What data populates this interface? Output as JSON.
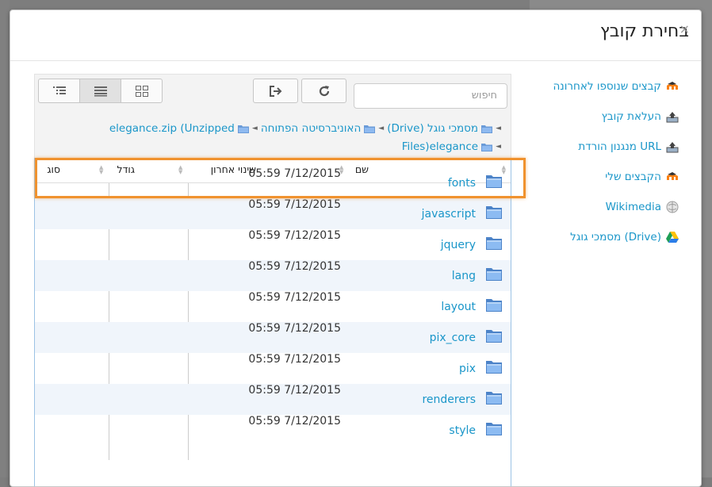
{
  "dialog": {
    "title": "בחירת קובץ",
    "close_glyph": "×"
  },
  "sidebar": {
    "items": [
      {
        "label": "קבצים שנוספו לאחרונה",
        "icon": "moodle-icon"
      },
      {
        "label": "העלאת קובץ",
        "icon": "upload-icon"
      },
      {
        "label": "מנגנון הורדת URL",
        "icon": "url-download-icon"
      },
      {
        "label": "הקבצים שלי",
        "icon": "moodle-icon"
      },
      {
        "label": "Wikimedia",
        "icon": "wikimedia-icon"
      },
      {
        "label": "מסמכי גוגל (Drive)",
        "icon": "google-drive-icon"
      }
    ]
  },
  "toolbar": {
    "search_placeholder": "חיפוש"
  },
  "breadcrumb": {
    "items": [
      "מסמכי גוגל (Drive)",
      "האוניברסיטה הפתוחה",
      "elegance.zip (Unzipped",
      "Files)elegance"
    ]
  },
  "table": {
    "columns": [
      "שם",
      "שינוי אחרון",
      "גודל",
      "סוג"
    ],
    "rows": [
      {
        "name": "fonts",
        "modified": "05:59 7/12/2015"
      },
      {
        "name": "javascript",
        "modified": "05:59 7/12/2015"
      },
      {
        "name": "jquery",
        "modified": "05:59 7/12/2015"
      },
      {
        "name": "lang",
        "modified": "05:59 7/12/2015"
      },
      {
        "name": "layout",
        "modified": "05:59 7/12/2015"
      },
      {
        "name": "pix_core",
        "modified": "05:59 7/12/2015"
      },
      {
        "name": "pix",
        "modified": "05:59 7/12/2015"
      },
      {
        "name": "renderers",
        "modified": "05:59 7/12/2015"
      },
      {
        "name": "style",
        "modified": "05:59 7/12/2015"
      }
    ]
  },
  "colors": {
    "link": "#1a96c9",
    "highlight": "#f0922e",
    "row_alt": "#f0f5fb"
  }
}
